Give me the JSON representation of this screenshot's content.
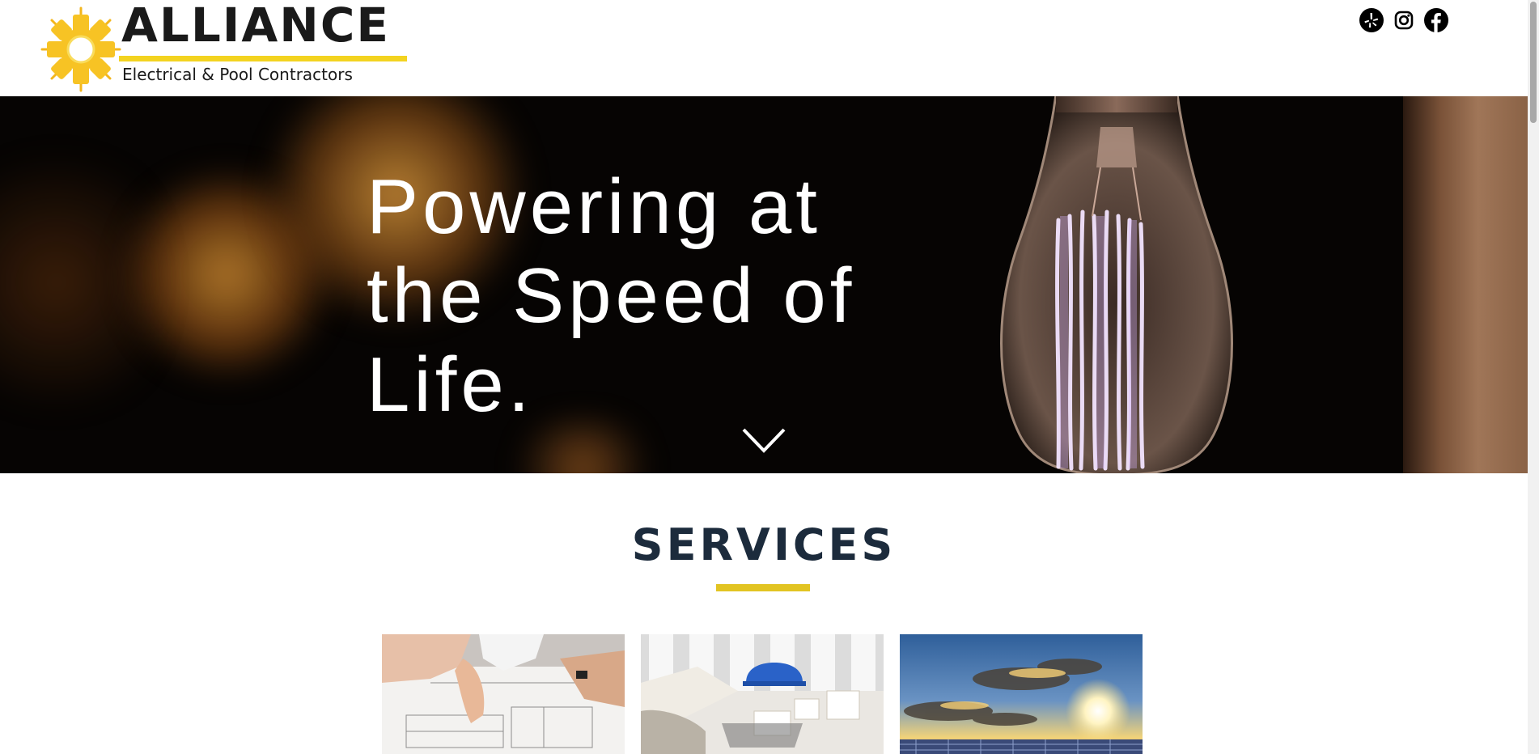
{
  "brand": {
    "name": "ALLIANCE",
    "tagline": "Electrical & Pool Contractors",
    "accent_color": "#f3d320"
  },
  "social": [
    {
      "name": "yelp-icon"
    },
    {
      "name": "instagram-icon"
    },
    {
      "name": "facebook-icon"
    }
  ],
  "hero": {
    "title": "Powering at the Speed of Life."
  },
  "services": {
    "heading": "SERVICES",
    "heading_color": "#1c2b3c",
    "underline_color": "#e2c422",
    "cards": [
      {
        "icon": "blueprint-image"
      },
      {
        "icon": "architecture-model-image"
      },
      {
        "icon": "solar-panel-sunset-image"
      }
    ]
  }
}
